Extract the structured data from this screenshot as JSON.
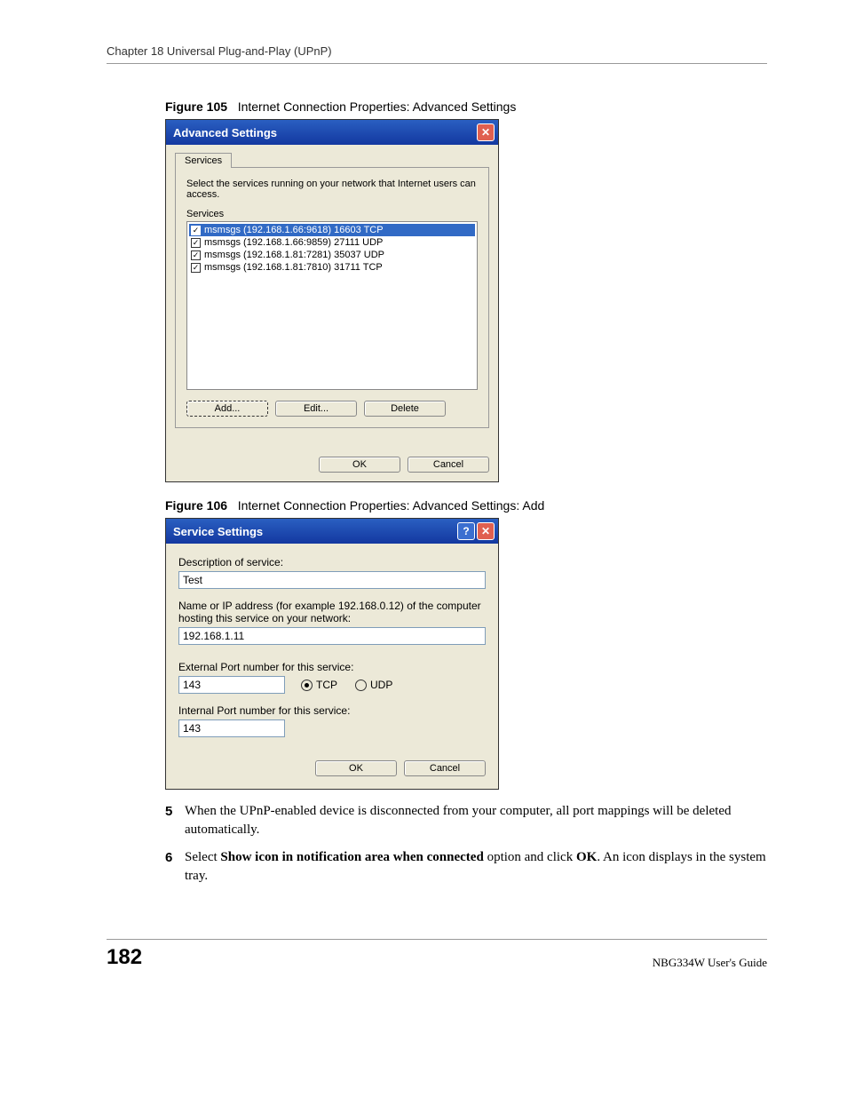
{
  "header": "Chapter 18 Universal Plug-and-Play (UPnP)",
  "fig105": {
    "label": "Figure 105",
    "caption": "Internet Connection Properties: Advanced Settings",
    "title": "Advanced Settings",
    "tab": "Services",
    "description": "Select the services running on your network that Internet users can access.",
    "list_label": "Services",
    "items": [
      {
        "text": "msmsgs (192.168.1.66:9618) 16603 TCP",
        "checked": true,
        "selected": true
      },
      {
        "text": "msmsgs (192.168.1.66:9859) 27111 UDP",
        "checked": true,
        "selected": false
      },
      {
        "text": "msmsgs (192.168.1.81:7281) 35037 UDP",
        "checked": true,
        "selected": false
      },
      {
        "text": "msmsgs (192.168.1.81:7810) 31711 TCP",
        "checked": true,
        "selected": false
      }
    ],
    "buttons": {
      "add": "Add...",
      "edit": "Edit...",
      "delete": "Delete",
      "ok": "OK",
      "cancel": "Cancel"
    }
  },
  "fig106": {
    "label": "Figure 106",
    "caption": "Internet Connection Properties: Advanced Settings: Add",
    "title": "Service Settings",
    "desc_label": "Description of service:",
    "desc_value": "Test",
    "host_label": "Name or IP address (for example 192.168.0.12) of the computer hosting this service on your network:",
    "host_value": "192.168.1.11",
    "ext_label": "External Port number for this service:",
    "ext_value": "143",
    "proto_tcp": "TCP",
    "proto_udp": "UDP",
    "int_label": "Internal Port number for this service:",
    "int_value": "143",
    "ok": "OK",
    "cancel": "Cancel"
  },
  "steps": {
    "s5_num": "5",
    "s5_text_a": "When the UPnP-enabled device is disconnected from your computer, all port mappings will be deleted automatically.",
    "s6_num": "6",
    "s6_prefix": "Select ",
    "s6_bold1": "Show icon in notification area when connected",
    "s6_mid": " option and click ",
    "s6_bold2": "OK",
    "s6_suffix": ". An icon displays in the system tray."
  },
  "footer": {
    "page": "182",
    "guide": "NBG334W User's Guide"
  }
}
